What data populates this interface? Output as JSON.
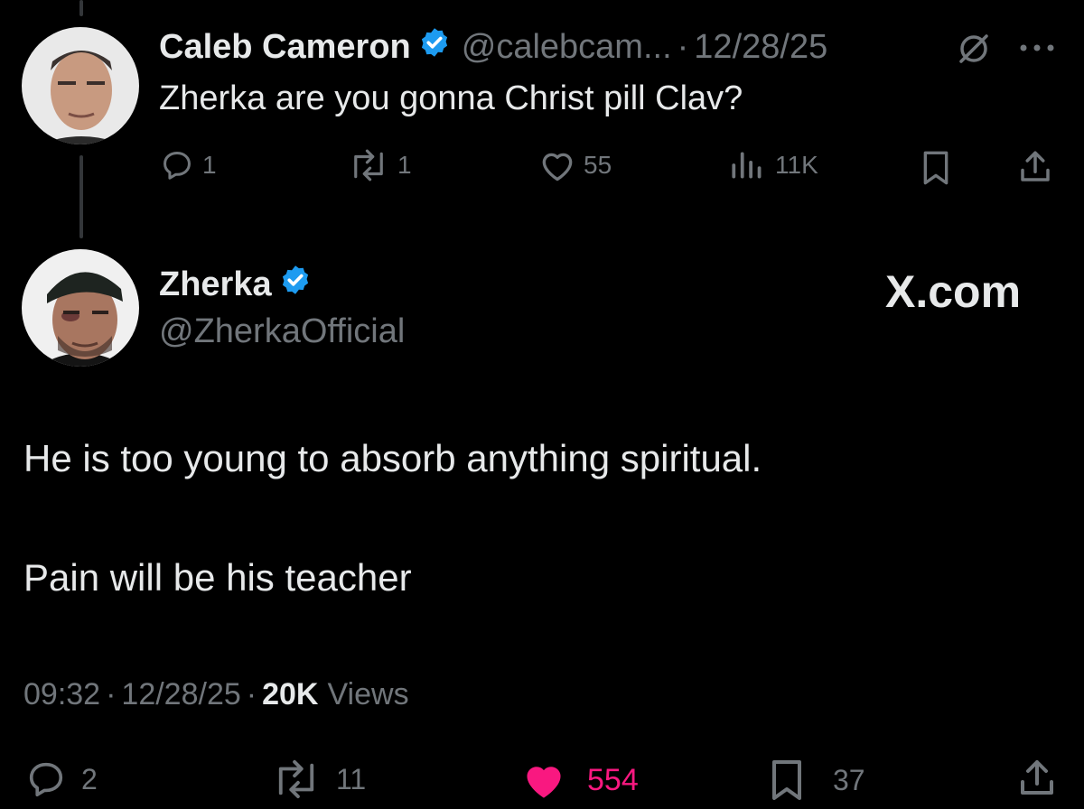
{
  "reply_tweet": {
    "author_name": "Caleb Cameron",
    "handle": "@calebcam...",
    "separator": "·",
    "date": "12/28/25",
    "text": "Zherka are you gonna Christ pill Clav?",
    "actions": {
      "replies": "1",
      "reposts": "1",
      "likes": "55",
      "views": "11K"
    },
    "icons": [
      "grok-icon",
      "more-icon",
      "reply-icon",
      "repost-icon",
      "like-icon",
      "views-icon",
      "bookmark-icon",
      "share-icon"
    ]
  },
  "main_tweet": {
    "author_name": "Zherka",
    "handle": "@ZherkaOfficial",
    "site_label": "X.com",
    "paragraphs": [
      "He is too young to absorb anything spiritual.",
      "Pain will be his teacher"
    ],
    "meta": {
      "time": "09:32",
      "sep1": "·",
      "date": "12/28/25",
      "sep2": "·",
      "views_count": "20K",
      "views_label": "Views"
    },
    "actions": {
      "replies": "2",
      "reposts": "11",
      "likes": "554",
      "bookmarks": "37"
    }
  },
  "colors": {
    "background": "#000000",
    "text": "#e7e9ea",
    "muted": "#71767b",
    "verified": "#1d9bf0",
    "like_active": "#f91880"
  }
}
